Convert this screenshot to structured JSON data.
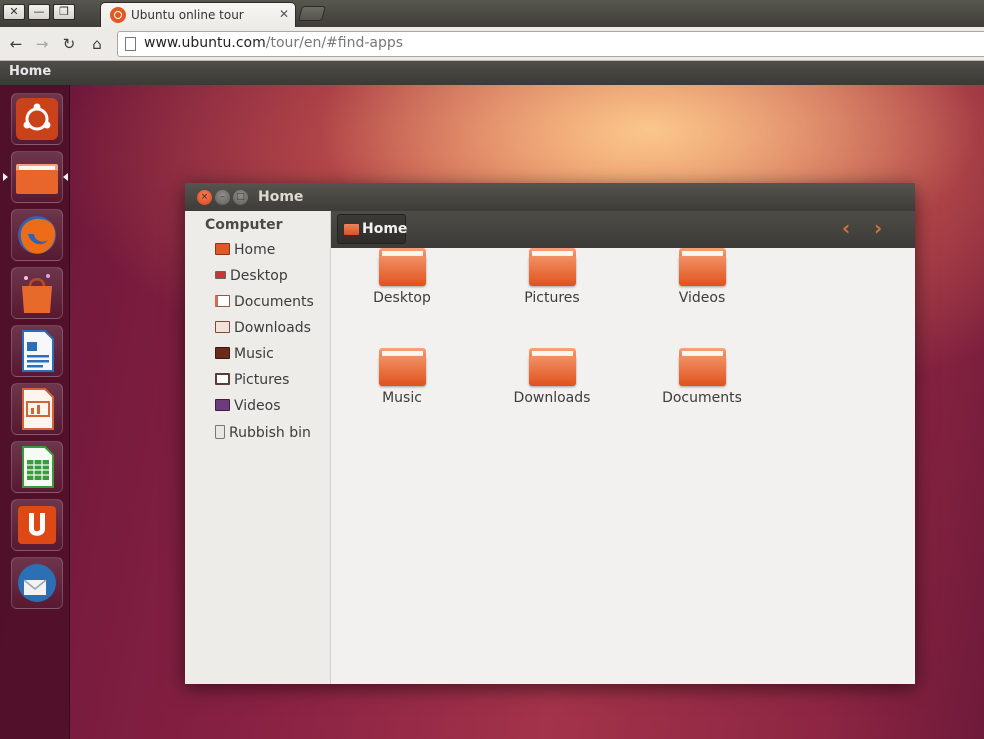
{
  "browser": {
    "window_buttons": [
      "✕",
      "—",
      "❐"
    ],
    "tab_title": "Ubuntu online tour",
    "tab_close": "✕",
    "url_host": "www.ubuntu.com",
    "url_path": "/tour/en/#find-apps",
    "nav": {
      "back": "←",
      "forward": "→",
      "reload": "↻",
      "home": "⌂"
    }
  },
  "panel": {
    "title": "Home"
  },
  "launcher": {
    "items": [
      {
        "name": "dash-home-icon",
        "color": "#e1571f"
      },
      {
        "name": "files-folder-icon",
        "color": "#ef7c4a"
      },
      {
        "name": "firefox-icon",
        "color": "#e66000"
      },
      {
        "name": "software-center-icon",
        "color": "#e86a2a"
      },
      {
        "name": "libreoffice-writer-icon",
        "color": "#2a6fb8"
      },
      {
        "name": "libreoffice-impress-icon",
        "color": "#d3643a"
      },
      {
        "name": "libreoffice-calc-icon",
        "color": "#3a9a3c"
      },
      {
        "name": "ubuntu-one-icon",
        "color": "#dd4814"
      },
      {
        "name": "thunderbird-icon",
        "color": "#2b6fb5"
      }
    ]
  },
  "window": {
    "title": "Home",
    "controls": {
      "close": "×",
      "minimize": "–",
      "maximize": "□"
    },
    "sidebar": {
      "heading": "Computer",
      "items": [
        {
          "label": "Home"
        },
        {
          "label": "Desktop"
        },
        {
          "label": "Documents"
        },
        {
          "label": "Downloads"
        },
        {
          "label": "Music"
        },
        {
          "label": "Pictures"
        },
        {
          "label": "Videos"
        },
        {
          "label": "Rubbish bin"
        }
      ]
    },
    "pathbar": {
      "crumb": "Home",
      "back_arrow": "‹",
      "forward_arrow": "›"
    },
    "files": [
      {
        "label": "Desktop"
      },
      {
        "label": "Pictures"
      },
      {
        "label": "Videos"
      },
      {
        "label": "Music"
      },
      {
        "label": "Downloads"
      },
      {
        "label": "Documents"
      }
    ]
  },
  "colors": {
    "accent": "#dd4814",
    "folder_orange": "#ec7d49",
    "desktop": "#8a2244"
  }
}
